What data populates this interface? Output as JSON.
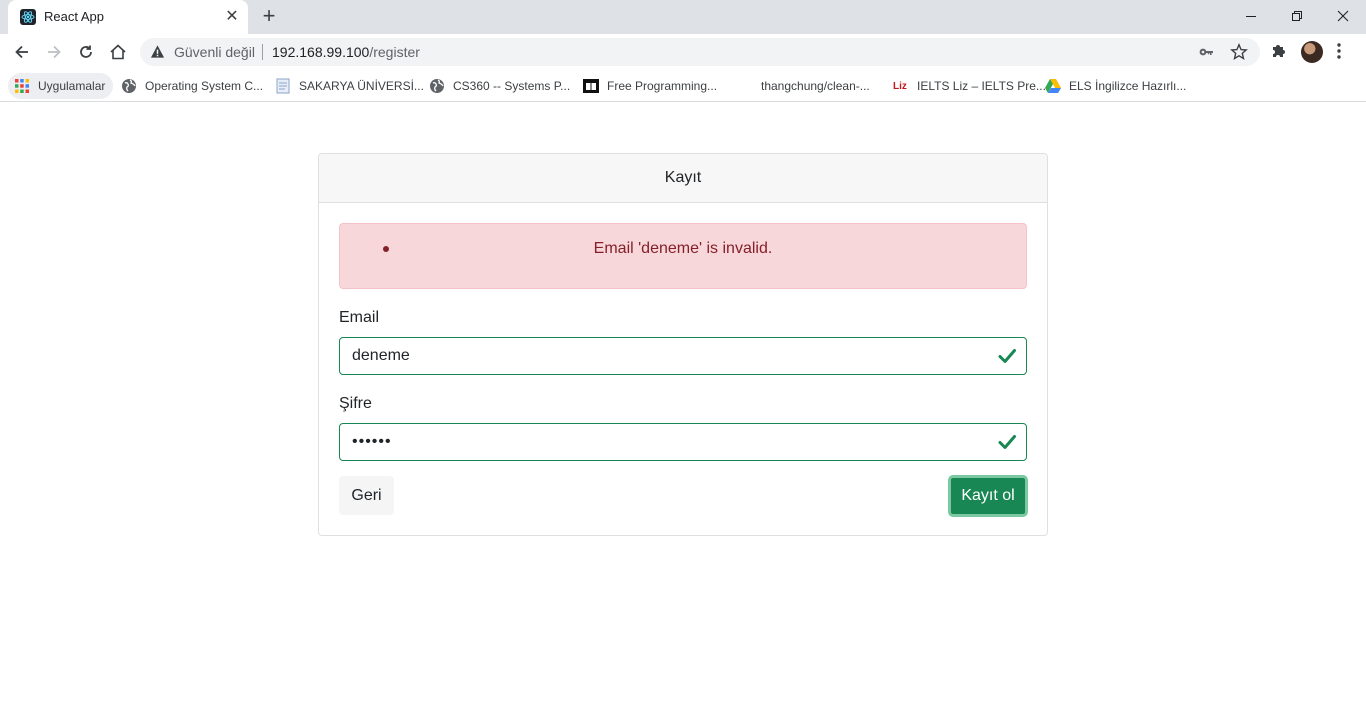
{
  "browser": {
    "tab_title": "React App",
    "tab_close": "✕",
    "new_tab": "+",
    "security_label": "Güvenli değil",
    "url_host": "192.168.99.100",
    "url_path": "/register"
  },
  "bookmarks": [
    {
      "label": "Uygulamalar",
      "icon": "apps-grid-icon"
    },
    {
      "label": "Operating System C...",
      "icon": "globe-icon"
    },
    {
      "label": "SAKARYA ÜNİVERSİ...",
      "icon": "document-icon"
    },
    {
      "label": "CS360 -- Systems P...",
      "icon": "globe-icon"
    },
    {
      "label": "Free Programming...",
      "icon": "book-icon"
    },
    {
      "label": "thangchung/clean-...",
      "icon": "none"
    },
    {
      "label": "IELTS Liz – IELTS Pre...",
      "icon": "liz-logo"
    },
    {
      "label": "ELS İngilizce Hazırlı...",
      "icon": "drive-icon"
    }
  ],
  "liz_logo_text": "Liz",
  "form": {
    "title": "Kayıt",
    "error_message": "Email 'deneme' is invalid.",
    "email_label": "Email",
    "email_value": "deneme",
    "password_label": "Şifre",
    "password_value": "••••••",
    "back_button": "Geri",
    "submit_button": "Kayıt ol"
  },
  "colors": {
    "success": "#198754",
    "danger_bg": "#f8d7da",
    "danger_text": "#842029"
  }
}
